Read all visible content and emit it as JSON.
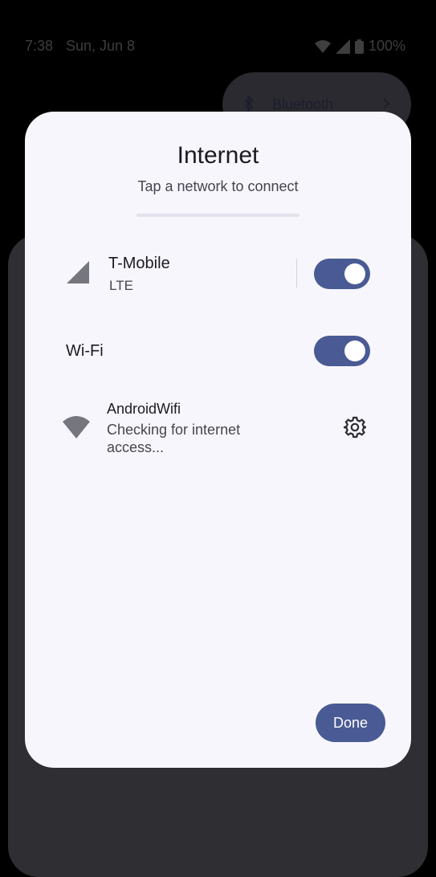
{
  "status_bar": {
    "time": "7:38",
    "date": "Sun, Jun 8",
    "battery": "100%"
  },
  "quick_settings": {
    "bluetooth_label": "Bluetooth"
  },
  "dialog": {
    "title": "Internet",
    "subtitle": "Tap a network to connect",
    "mobile": {
      "carrier": "T-Mobile",
      "network_type": "LTE",
      "enabled": true,
      "icon": "signal-icon"
    },
    "wifi": {
      "label": "Wi-Fi",
      "enabled": true
    },
    "networks": [
      {
        "name": "AndroidWifi",
        "status": "Checking for internet access...",
        "icon": "wifi-icon"
      }
    ],
    "done_label": "Done"
  },
  "colors": {
    "accent": "#4a5a94",
    "dialog_bg": "#f7f6fc",
    "backdrop": "#000000"
  }
}
